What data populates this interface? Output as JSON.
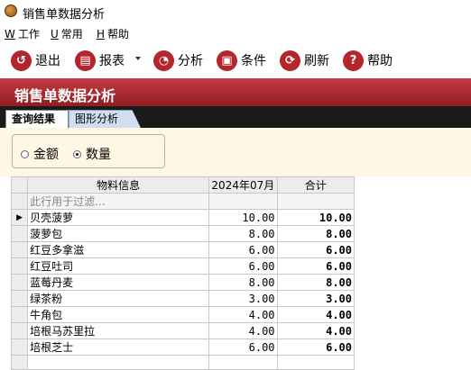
{
  "window": {
    "title": "销售单数据分析"
  },
  "menu": [
    {
      "key": "W",
      "label": "工作"
    },
    {
      "key": "U",
      "label": "常用"
    },
    {
      "key": "H",
      "label": "帮助"
    }
  ],
  "toolbar": {
    "exit": "退出",
    "report": "报表",
    "analyze": "分析",
    "condition": "条件",
    "refresh": "刷新",
    "help": "帮助"
  },
  "banner": {
    "title": "销售单数据分析"
  },
  "tabs": {
    "results": "查询结果",
    "chart": "图形分析"
  },
  "filter": {
    "amount": "金额",
    "quantity": "数量",
    "selected": "quantity"
  },
  "grid": {
    "columns": [
      "物料信息",
      "2024年07月",
      "合计"
    ],
    "filter_placeholder": "此行用于过滤...",
    "rows": [
      {
        "name": "贝壳菠萝",
        "month": "10.00",
        "total": "10.00"
      },
      {
        "name": "菠萝包",
        "month": "8.00",
        "total": "8.00"
      },
      {
        "name": "红豆多拿滋",
        "month": "6.00",
        "total": "6.00"
      },
      {
        "name": "红豆吐司",
        "month": "6.00",
        "total": "6.00"
      },
      {
        "name": "蓝莓丹麦",
        "month": "8.00",
        "total": "8.00"
      },
      {
        "name": "绿茶粉",
        "month": "3.00",
        "total": "3.00"
      },
      {
        "name": "牛角包",
        "month": "4.00",
        "total": "4.00"
      },
      {
        "name": "培根马苏里拉",
        "month": "4.00",
        "total": "4.00"
      },
      {
        "name": "培根芝士",
        "month": "6.00",
        "total": "6.00"
      }
    ]
  },
  "colors": {
    "banner": "#b3262c",
    "tab_bg": "#1a1a1a",
    "filter_bg": "#fff7e3"
  }
}
